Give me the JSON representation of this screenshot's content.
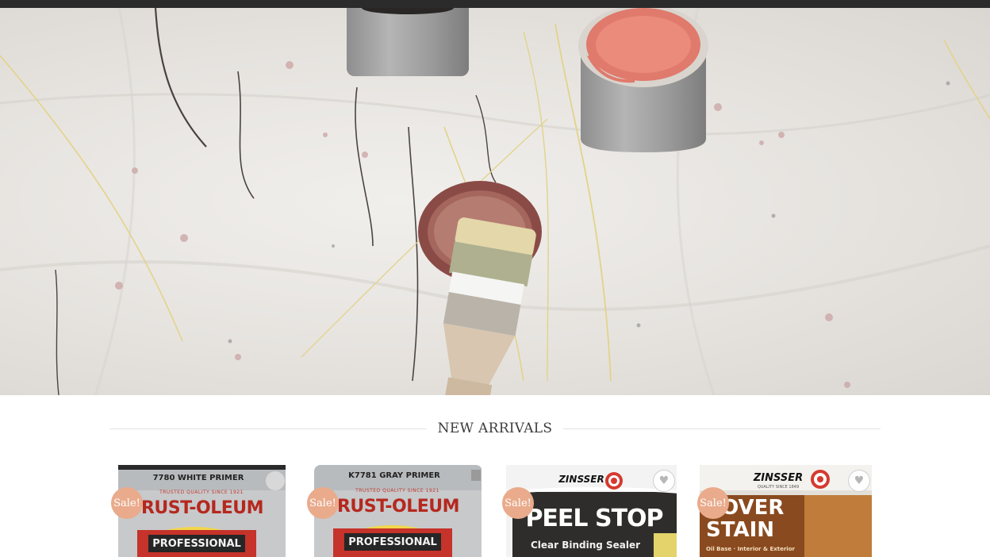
{
  "section": {
    "title": "NEW ARRIVALS"
  },
  "colors": {
    "topbar": "#2b2b2b",
    "sale_badge": "#e9ab8c",
    "section_rule": "#e4e4e4"
  },
  "hero": {
    "icons": [
      "paint-can-gray",
      "paint-can-coral",
      "paint-lid",
      "paint-brush"
    ]
  },
  "products": [
    {
      "badge": "Sale!",
      "brand": "RUST-OLEUM",
      "product_code": "7780  WHITE PRIMER",
      "tagline": "TRUSTED QUALITY SINCE 1921",
      "label": "PROFESSIONAL"
    },
    {
      "badge": "Sale!",
      "brand": "RUST-OLEUM",
      "product_code": "K7781  GRAY PRIMER",
      "tagline": "TRUSTED QUALITY SINCE 1921",
      "label": "PROFESSIONAL"
    },
    {
      "badge": "Sale!",
      "brand": "ZINSSER",
      "headline": "PEEL STOP",
      "subline": "Clear Binding Sealer"
    },
    {
      "badge": "Sale!",
      "brand": "ZINSSER",
      "tagline": "QUALITY SINCE 1849",
      "headline_line1": "COVER",
      "headline_line2": "STAIN",
      "subline": "Oil Base · Interior & Exterior"
    }
  ]
}
